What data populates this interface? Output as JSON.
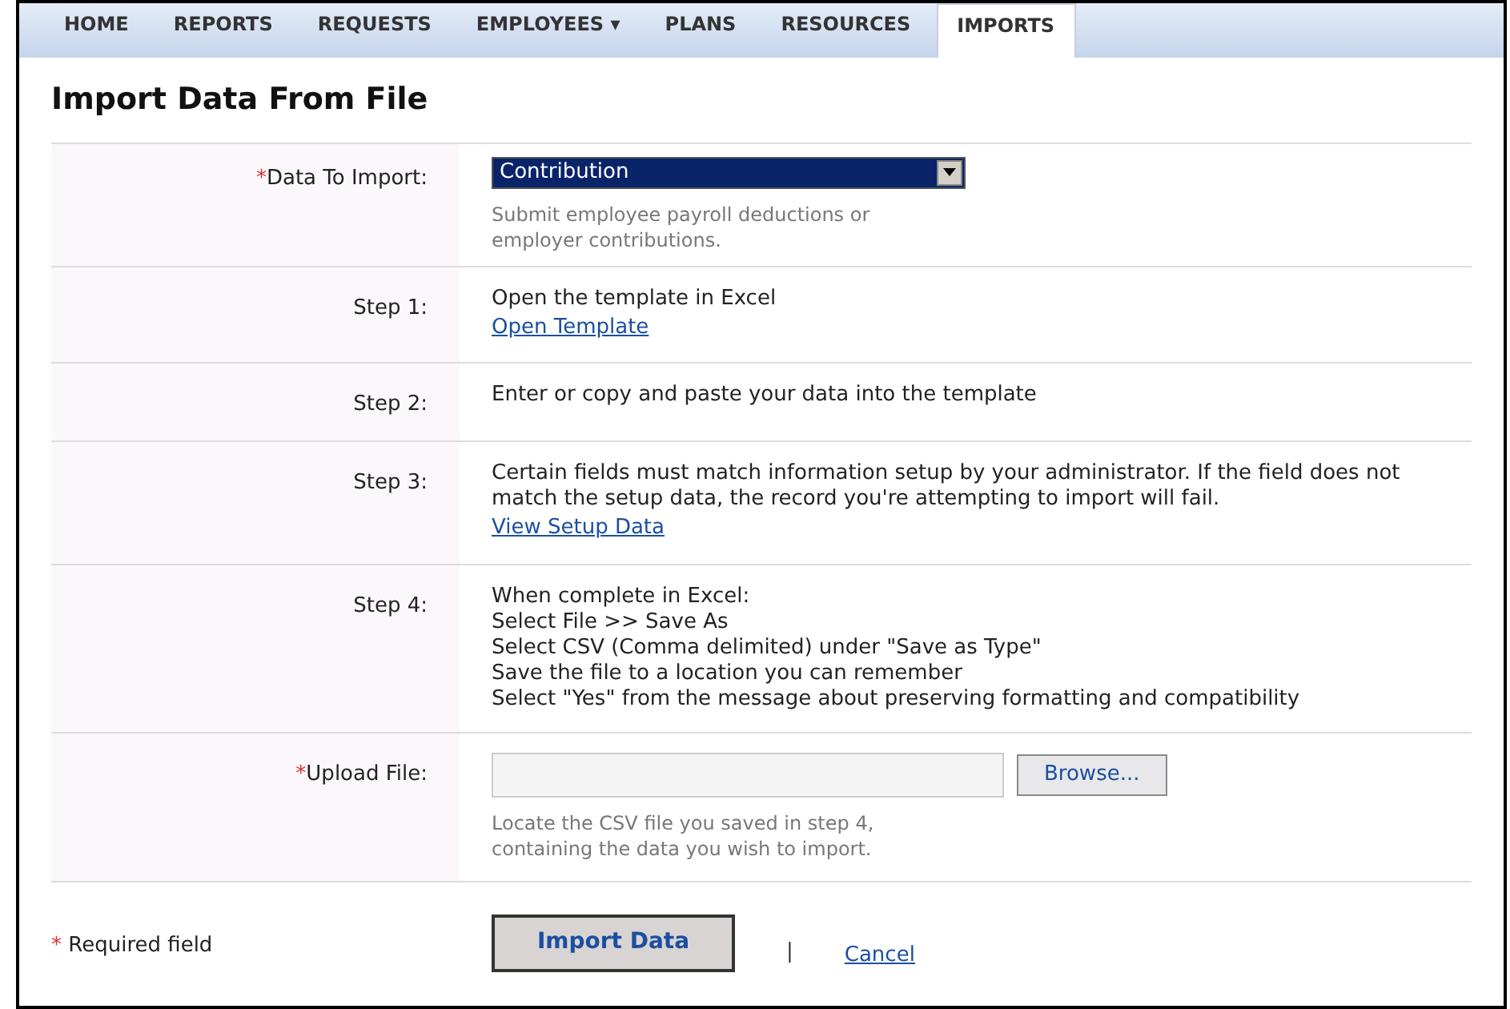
{
  "nav": [
    {
      "label": "HOME",
      "selected": false
    },
    {
      "label": "REPORTS",
      "selected": false
    },
    {
      "label": "REQUESTS",
      "selected": false
    },
    {
      "label": "EMPLOYEES ▾",
      "selected": false
    },
    {
      "label": "PLANS",
      "selected": false
    },
    {
      "label": "RESOURCES",
      "selected": false
    },
    {
      "label": "IMPORTS",
      "selected": true
    }
  ],
  "title": "Import Data From File",
  "data_to_import": {
    "required_mark": "*",
    "label": "Data To Import:",
    "value": "Contribution",
    "help": "Submit employee payroll deductions or employer contributions."
  },
  "steps": [
    {
      "label": "Step 1:",
      "lines": [
        "Open the template in Excel"
      ],
      "link": "Open Template"
    },
    {
      "label": "Step 2:",
      "lines": [
        "Enter or copy and paste your data into the template"
      ]
    },
    {
      "label": "Step 3:",
      "lines": [
        "Certain fields must match information setup by your administrator. If the field does not match the setup data, the record you're attempting to import will fail."
      ],
      "link": "View Setup Data"
    },
    {
      "label": "Step 4:",
      "lines": [
        "When complete in Excel:",
        "Select File >> Save As",
        "Select CSV (Comma delimited) under \"Save as Type\"",
        "Save the file to a location you can remember",
        "Select \"Yes\" from the message about preserving formatting and compatibility"
      ]
    }
  ],
  "upload": {
    "required_mark": "*",
    "label": "Upload File:",
    "browse": "Browse...",
    "help": "Locate the CSV file you saved in step 4, containing the data you wish to import."
  },
  "footer": {
    "required_mark": "*",
    "required_note": "Required field",
    "submit": "Import Data",
    "separator": "|",
    "cancel": "Cancel"
  }
}
